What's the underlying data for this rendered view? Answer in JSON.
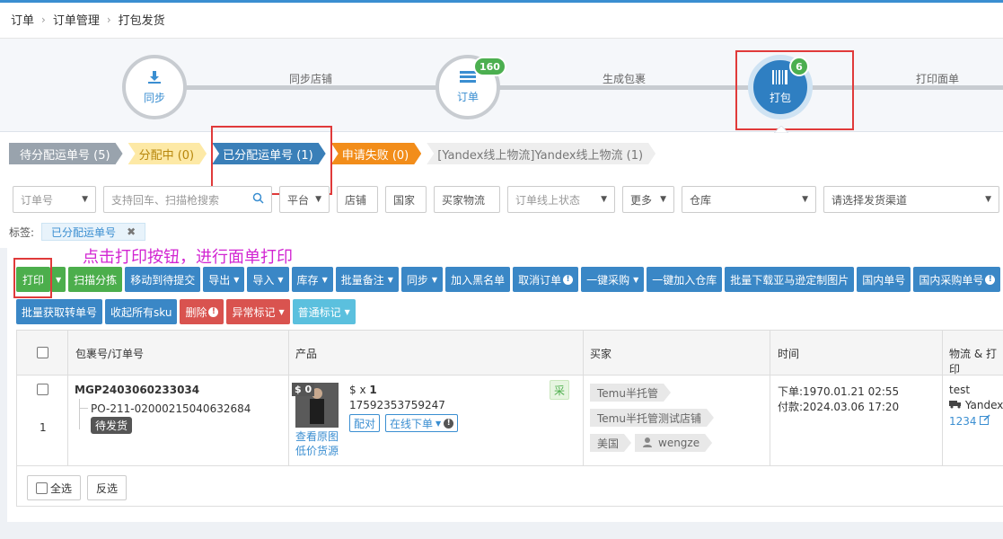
{
  "breadcrumb": [
    "订单",
    "订单管理",
    "打包发货"
  ],
  "steps": {
    "sync": {
      "label": "同步",
      "icon": "download-icon"
    },
    "sync_store": "同步店铺",
    "order": {
      "label": "订单",
      "badge": "160",
      "icon": "list-icon"
    },
    "gen_package": "生成包裹",
    "pack": {
      "label": "打包",
      "badge": "6",
      "icon": "barcode-icon"
    },
    "print_label": "打印面单"
  },
  "status_tabs": [
    "待分配运单号 (5)",
    "分配中 (0)",
    "已分配运单号 (1)",
    "申请失败 (0)",
    "[Yandex线上物流]Yandex线上物流 (1)"
  ],
  "filters": {
    "order_no": "订单号",
    "search_placeholder": "支持回车、扫描枪搜索",
    "platform": "平台",
    "store": "店铺",
    "country": "国家",
    "buyer_logistics": "买家物流",
    "online_status": "订单线上状态",
    "more": "更多",
    "warehouse": "仓库",
    "shipping_channel": "请选择发货渠道"
  },
  "tags": {
    "label": "标签:",
    "chip": "已分配运单号",
    "remove": "✖"
  },
  "hint": "点击打印按钮，进行面单打印",
  "toolbar_row1": {
    "print": "打印",
    "scan_sort": "扫描分拣",
    "move_to_pending": "移动到待提交",
    "export": "导出",
    "import": "导入",
    "stock": "库存",
    "batch_note": "批量备注",
    "sync": "同步",
    "blacklist": "加入黑名单",
    "cancel_order": "取消订单",
    "one_click_purchase": "一键采购",
    "one_click_warehouse": "一键加入仓库",
    "batch_download_amazon": "批量下载亚马逊定制图片",
    "domestic_order": "国内单号",
    "domestic_purchase": "国内采购单号"
  },
  "toolbar_row2": {
    "batch_transfer": "批量获取转单号",
    "collect_sku": "收起所有sku",
    "delete": "删除",
    "abnormal_mark": "异常标记",
    "normal_mark": "普通标记"
  },
  "table": {
    "headers": {
      "package_order": "包裹号/订单号",
      "product": "产品",
      "buyer": "买家",
      "time": "时间",
      "logistics": "物流 & 打印"
    },
    "row": {
      "index": "1",
      "package_no": "MGP2403060233034",
      "order_no": "PO-211-02000215040632684",
      "status": "待发货",
      "price_tag": "$ 0",
      "price": "$ x ",
      "qty": "1",
      "sku": "17592353759247",
      "match": "配对",
      "online_order": "在线下单",
      "view_image": "查看原图",
      "low_price_source": "低价货源",
      "cai": "采",
      "buyer_tags": [
        "Temu半托管",
        "Temu半托管测试店铺",
        "美国"
      ],
      "buyer_name": "wengze",
      "order_time": "下单:1970.01.21 02:55",
      "pay_time": "付款:2024.03.06 17:20",
      "logistics_name": "test",
      "carrier": "Yandex",
      "tracking": "1234"
    }
  },
  "footer": {
    "select_all": "全选",
    "invert": "反选"
  }
}
